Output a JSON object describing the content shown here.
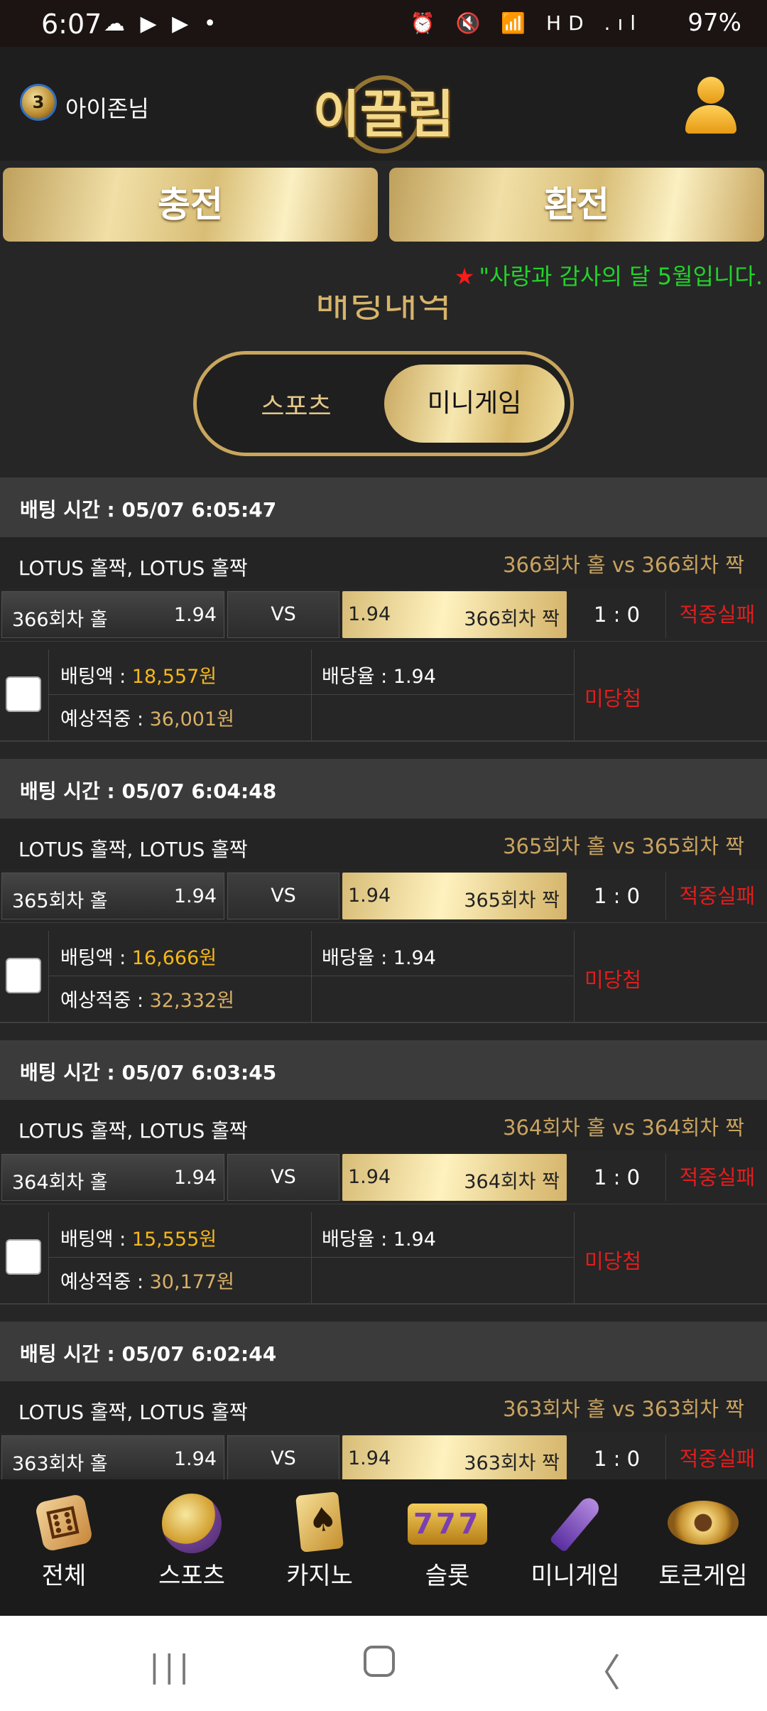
{
  "status_bar": {
    "time": "6:07",
    "left_icons": "☁ ▶ ▶ •",
    "right_icons": "⏰ 🔇 📶 HD .ıl",
    "battery": "97%"
  },
  "header": {
    "user_level": "3",
    "user_name": "아이존님",
    "logo_text": "이끌림"
  },
  "actions": {
    "charge": "충전",
    "exchange": "환전"
  },
  "notice": {
    "star": "★",
    "text": "\"사랑과 감사의 달 5월입니다."
  },
  "section_title": "배팅내역",
  "toggle": {
    "sports": "스포츠",
    "minigame": "미니게임"
  },
  "bets": [
    {
      "time": "배팅 시간 : 05/07 6:05:47",
      "game": "LOTUS 홀짝, LOTUS 홀짝",
      "matchup": "366회차 홀  vs  366회차 짝",
      "home_label": "366회차 홀",
      "home_odds": "1.94",
      "vs": "VS",
      "away_odds": "1.94",
      "away_label": "366회차 짝",
      "score": "1 : 0",
      "result": "적중실패",
      "amount_label": "배팅액 : ",
      "amount": "18,557원",
      "rate_label": "배당율 : 1.94",
      "expected_label": "예상적중 : ",
      "expected": "36,001원",
      "outcome": "미당첨"
    },
    {
      "time": "배팅 시간 : 05/07 6:04:48",
      "game": "LOTUS 홀짝, LOTUS 홀짝",
      "matchup": "365회차 홀  vs  365회차 짝",
      "home_label": "365회차 홀",
      "home_odds": "1.94",
      "vs": "VS",
      "away_odds": "1.94",
      "away_label": "365회차 짝",
      "score": "1 : 0",
      "result": "적중실패",
      "amount_label": "배팅액 : ",
      "amount": "16,666원",
      "rate_label": "배당율 : 1.94",
      "expected_label": "예상적중 : ",
      "expected": "32,332원",
      "outcome": "미당첨"
    },
    {
      "time": "배팅 시간 : 05/07 6:03:45",
      "game": "LOTUS 홀짝, LOTUS 홀짝",
      "matchup": "364회차 홀  vs  364회차 짝",
      "home_label": "364회차 홀",
      "home_odds": "1.94",
      "vs": "VS",
      "away_odds": "1.94",
      "away_label": "364회차 짝",
      "score": "1 : 0",
      "result": "적중실패",
      "amount_label": "배팅액 : ",
      "amount": "15,555원",
      "rate_label": "배당율 : 1.94",
      "expected_label": "예상적중 : ",
      "expected": "30,177원",
      "outcome": "미당첨"
    },
    {
      "time": "배팅 시간 : 05/07 6:02:44",
      "game": "LOTUS 홀짝, LOTUS 홀짝",
      "matchup": "363회차 홀  vs  363회차 짝",
      "home_label": "363회차 홀",
      "home_odds": "1.94",
      "vs": "VS",
      "away_odds": "1.94",
      "away_label": "363회차 짝",
      "score": "1 : 0",
      "result": "적중실패"
    }
  ],
  "bottom_nav": [
    {
      "label": "전체",
      "icon": "dice-icon"
    },
    {
      "label": "스포츠",
      "icon": "soccer-ball-icon"
    },
    {
      "label": "카지노",
      "icon": "cards-icon"
    },
    {
      "label": "슬롯",
      "icon": "slot-777-icon"
    },
    {
      "label": "미니게임",
      "icon": "rocket-icon"
    },
    {
      "label": "토큰게임",
      "icon": "roulette-icon"
    }
  ],
  "android_nav": {
    "recents": "|||",
    "back": "〈"
  }
}
